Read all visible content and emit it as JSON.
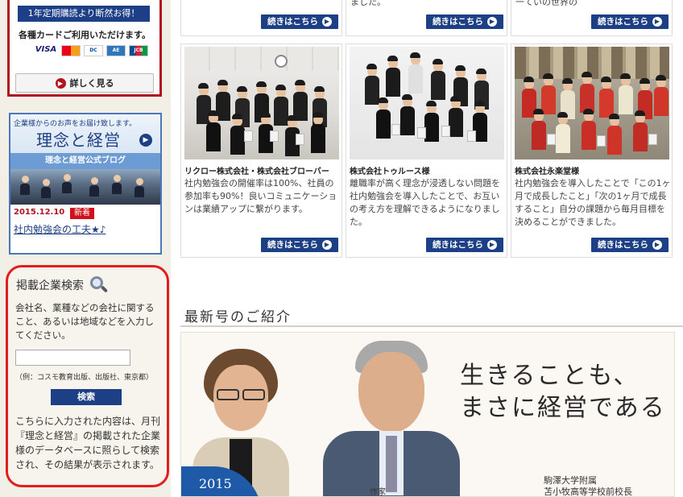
{
  "sidebar": {
    "campaign": {
      "banner": "1年定期購読より断然お得！",
      "cards_text": "各種カードご利用いただけます。",
      "card_logos": [
        "VISA",
        "MasterCard",
        "Diners",
        "AMEX",
        "JCB"
      ],
      "detail_label": "詳しく見る"
    },
    "blog": {
      "heading": "企業様からのお声をお届け致します。",
      "logo_text": "理念と経営",
      "bar_text": "理念と経営公式ブログ",
      "date": "2015.12.10",
      "new_badge": "新着",
      "link_text": "社内勉強会の工夫★♪"
    },
    "search": {
      "title": "掲載企業検索",
      "description": "会社名、業種などの会社に関すること、あるいは地域などを入力してください。",
      "input_value": "",
      "example": "（例：コスモ教育出版、出版社、東京都）",
      "button_label": "検索",
      "note": "こちらに入力された内容は、月刊『理念と経営』の掲載された企業様のデータベースに照らして検索され、その結果が表示されます。"
    }
  },
  "main": {
    "more_label": "続きはこちら",
    "top_stubs": [
      {
        "text": ""
      },
      {
        "text": "ました。"
      },
      {
        "text": "一ていの世界の"
      }
    ],
    "cases": [
      {
        "company": "リクロー株式会社・株式会社ブローバー",
        "text": "社内勉強会の開催率は100%、社員の参加率も90%！良いコミュニケーションは業績アップに繋がります。"
      },
      {
        "company": "株式会社トゥルース様",
        "text": "離職率が高く理念が浸透しない問題を社内勉強会を導入したことで、お互いの考え方を理解できるようになりました。"
      },
      {
        "company": "株式会社永楽堂様",
        "text": "社内勉強会を導入したことで「この1ヶ月で成長したこと」「次の1ヶ月で成長すること」自分の課題から毎月目標を決めることができました。"
      }
    ],
    "latest": {
      "title": "最新号のご紹介",
      "headline_line1": "生きることも、",
      "headline_line2": "まさに経営である",
      "year": "2015",
      "caption_line1": "駒澤大学附属",
      "caption_line2": "苫小牧高等学校前校長",
      "caption_left": "作家"
    }
  },
  "colors": {
    "navy": "#1c3f86",
    "red_border": "#e31d1d",
    "campaign_red": "#b0151e",
    "sidebar_bg": "#f2efe6"
  }
}
